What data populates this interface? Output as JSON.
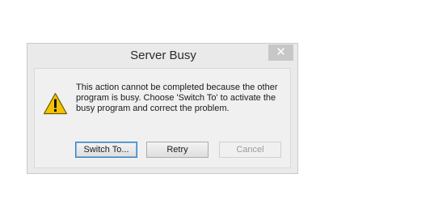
{
  "dialog": {
    "title": "Server Busy",
    "close_glyph": "✕",
    "icon": "warning-icon",
    "message": "This action cannot be completed because the other program is busy. Choose 'Switch To' to activate the busy program and correct the problem.",
    "buttons": {
      "switch_to": "Switch To...",
      "retry": "Retry",
      "cancel": "Cancel"
    }
  },
  "colors": {
    "warning_yellow": "#f5c400",
    "close_button_bg": "#c7c7c7",
    "default_button_border": "#3c7fb1"
  }
}
